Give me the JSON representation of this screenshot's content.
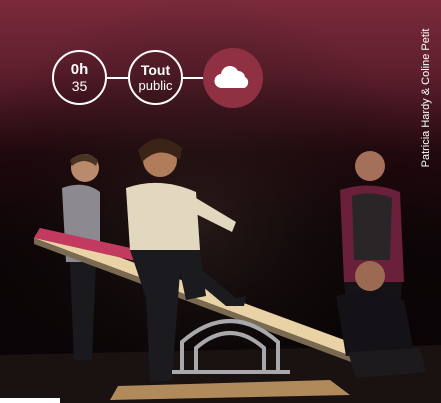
{
  "badges": {
    "duration": {
      "top": "0h",
      "bottom": "35"
    },
    "audience": {
      "top": "Tout",
      "bottom": "public"
    },
    "weather": {
      "icon": "cloud-icon"
    }
  },
  "credit": "Patricia Hardy & Coline Petit",
  "colors": {
    "accent": "#8f3142",
    "banner": "#7a2a3b"
  }
}
